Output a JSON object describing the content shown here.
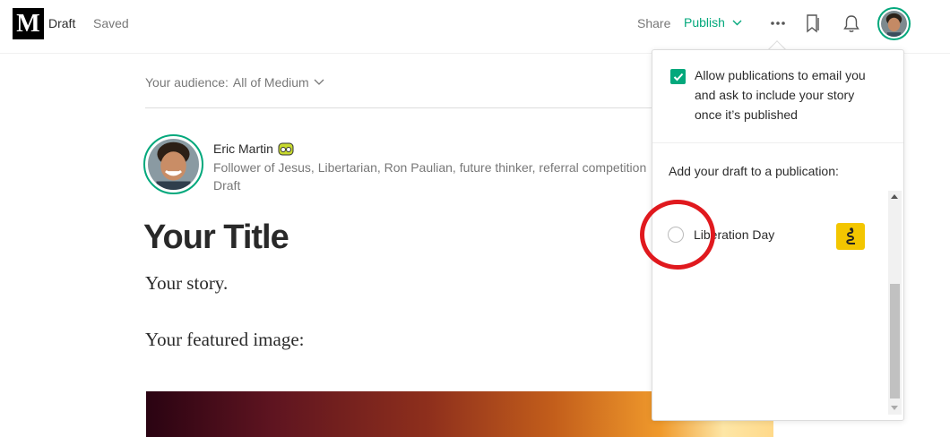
{
  "header": {
    "logo_letter": "M",
    "status": "Draft",
    "save_state": "Saved",
    "share_label": "Share",
    "publish_label": "Publish"
  },
  "editor": {
    "audience_label": "Your audience:",
    "audience_value": "All of Medium",
    "author": {
      "name": "Eric Martin",
      "bio": "Follower of Jesus, Libertarian, Ron Paulian, future thinker, referral competition",
      "status": "Draft"
    },
    "title": "Your Title",
    "body": "Your story.",
    "featured_label": "Your featured image:"
  },
  "popover": {
    "allow_text": "Allow publications to email you and ask to include your story once it’s published",
    "allow_checked": true,
    "add_label": "Add your draft to a publication:",
    "publications": [
      {
        "name": "Liberation Day",
        "selected": false
      }
    ]
  },
  "colors": {
    "accent": "#03a87c",
    "annotation": "#e0191e",
    "pub_logo_bg": "#f3c600"
  }
}
